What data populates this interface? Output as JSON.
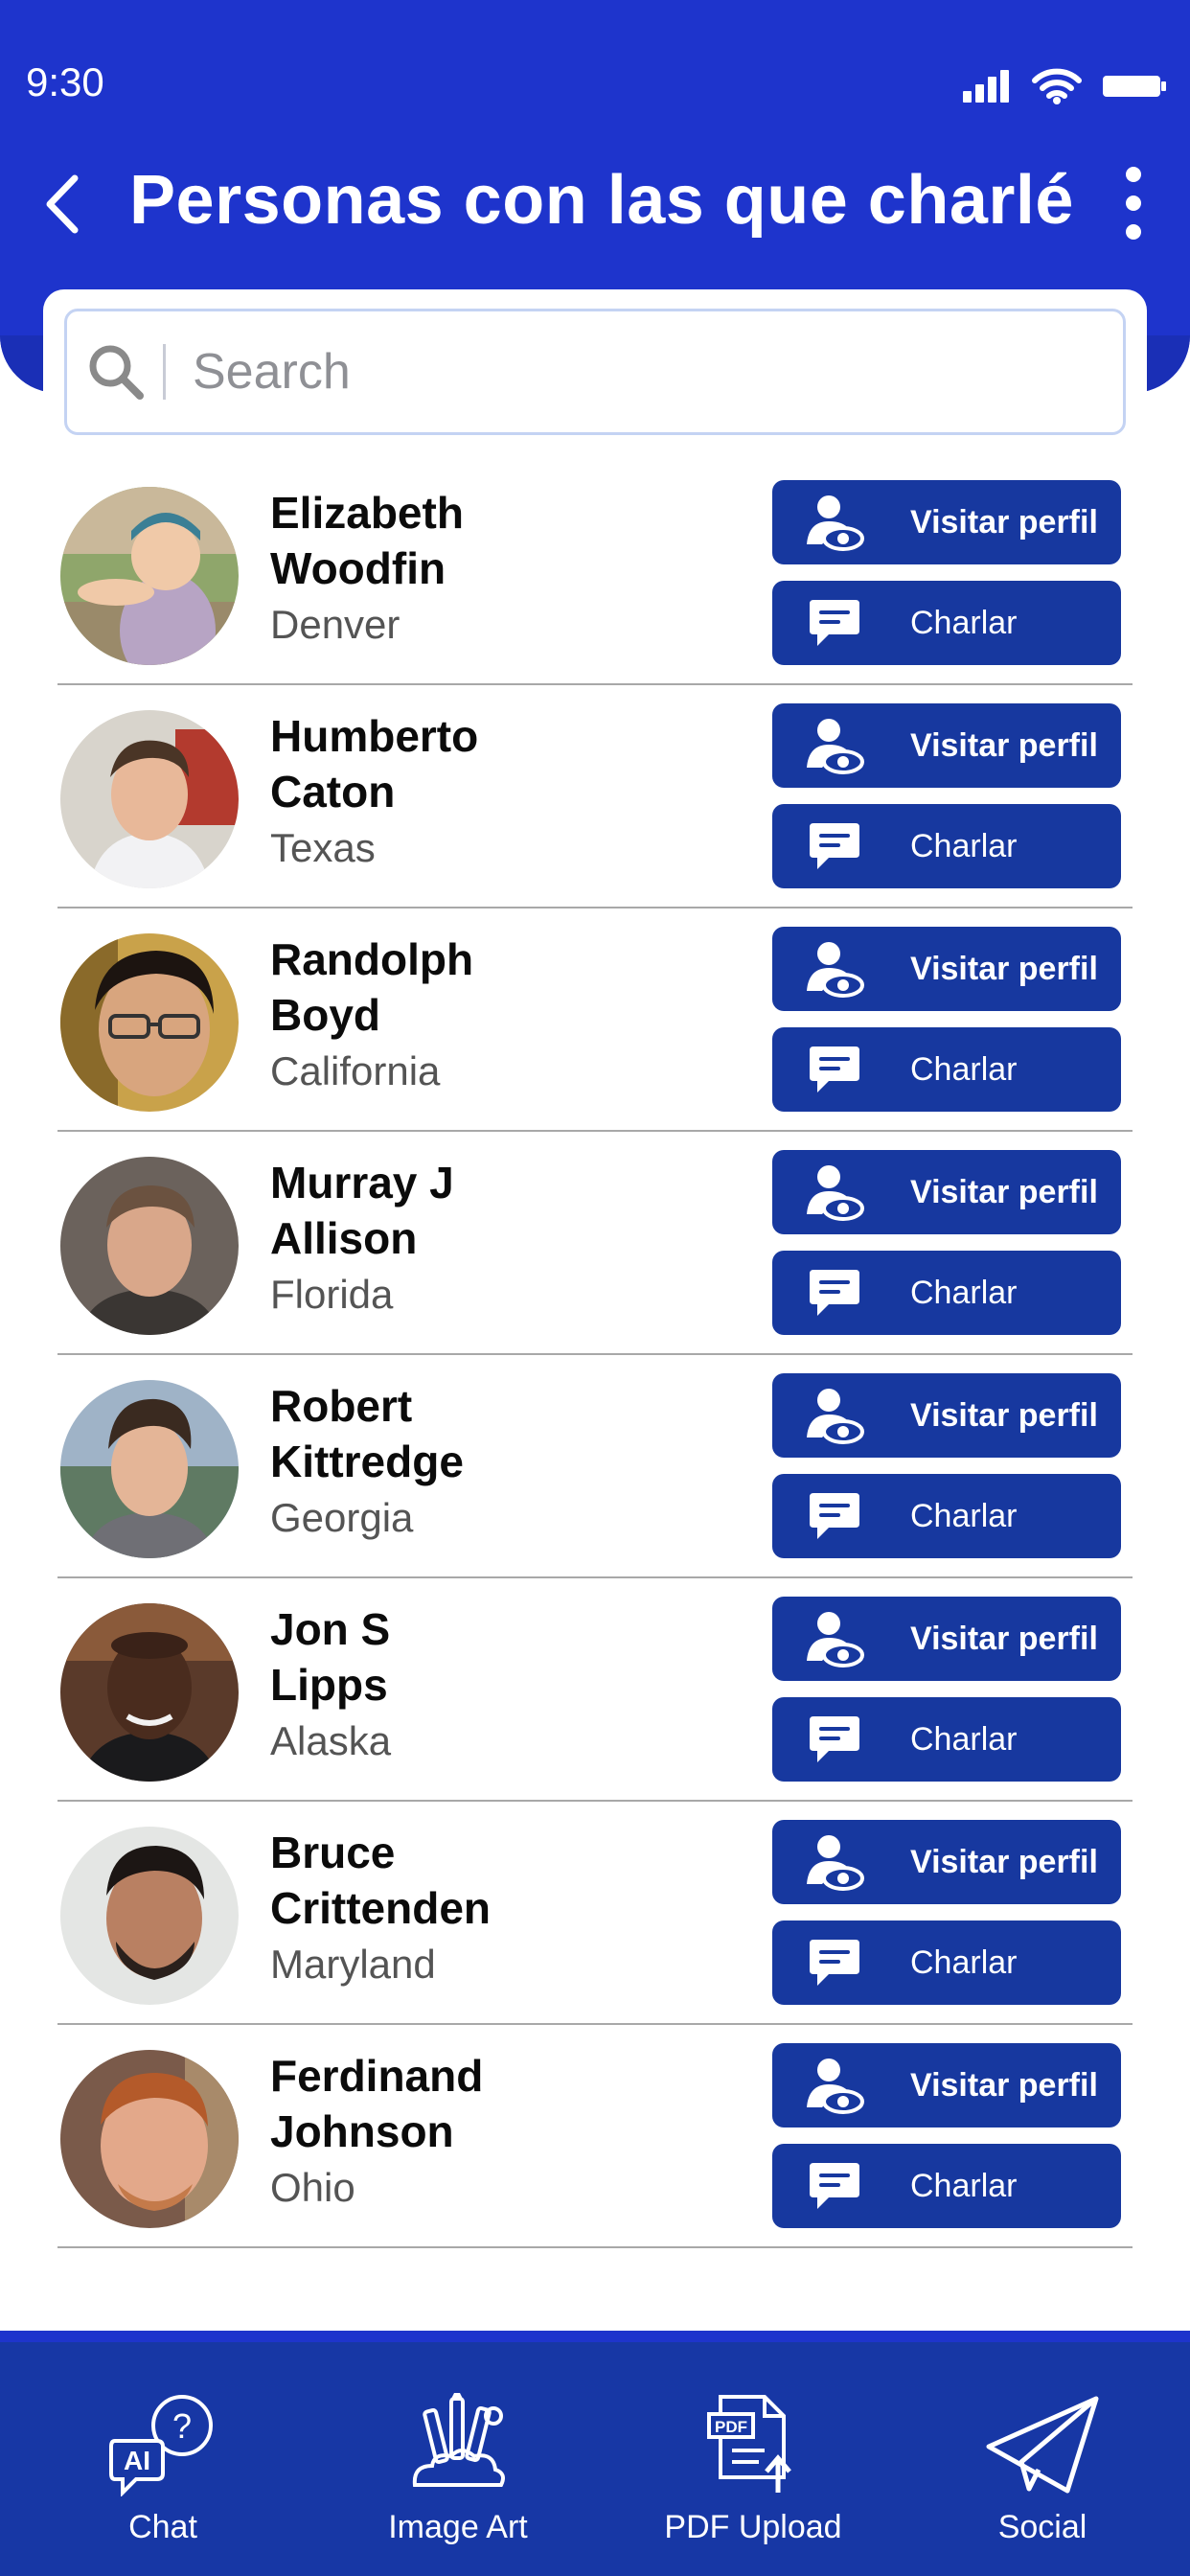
{
  "status_bar": {
    "time": "9:30"
  },
  "header": {
    "title": "Personas con las que charlé"
  },
  "search": {
    "placeholder": "Search",
    "value": ""
  },
  "buttons": {
    "visit_label": "Visitar perfil",
    "chat_label": "Charlar"
  },
  "contacts": [
    {
      "first": "Elizabeth",
      "last": "Woodfin",
      "location": "Denver"
    },
    {
      "first": "Humberto",
      "last": "Caton",
      "location": "Texas"
    },
    {
      "first": "Randolph",
      "last": "Boyd",
      "location": "California"
    },
    {
      "first": "Murray J",
      "last": "Allison",
      "location": "Florida"
    },
    {
      "first": "Robert",
      "last": "Kittredge",
      "location": "Georgia"
    },
    {
      "first": "Jon S",
      "last": "Lipps",
      "location": "Alaska"
    },
    {
      "first": "Bruce",
      "last": "Crittenden",
      "location": "Maryland"
    },
    {
      "first": "Ferdinand",
      "last": "Johnson",
      "location": "Ohio"
    }
  ],
  "bottom_nav": [
    {
      "label": "Chat",
      "icon": "ai-chat-icon"
    },
    {
      "label": "Image Art",
      "icon": "art-supplies-icon"
    },
    {
      "label": "PDF Upload",
      "icon": "pdf-upload-icon"
    },
    {
      "label": "Social",
      "icon": "paper-plane-icon"
    }
  ],
  "colors": {
    "header_blue": "#1e34cc",
    "button_blue": "#17389f",
    "nav_blue": "#1737a5",
    "search_border": "#c4d3f3"
  }
}
